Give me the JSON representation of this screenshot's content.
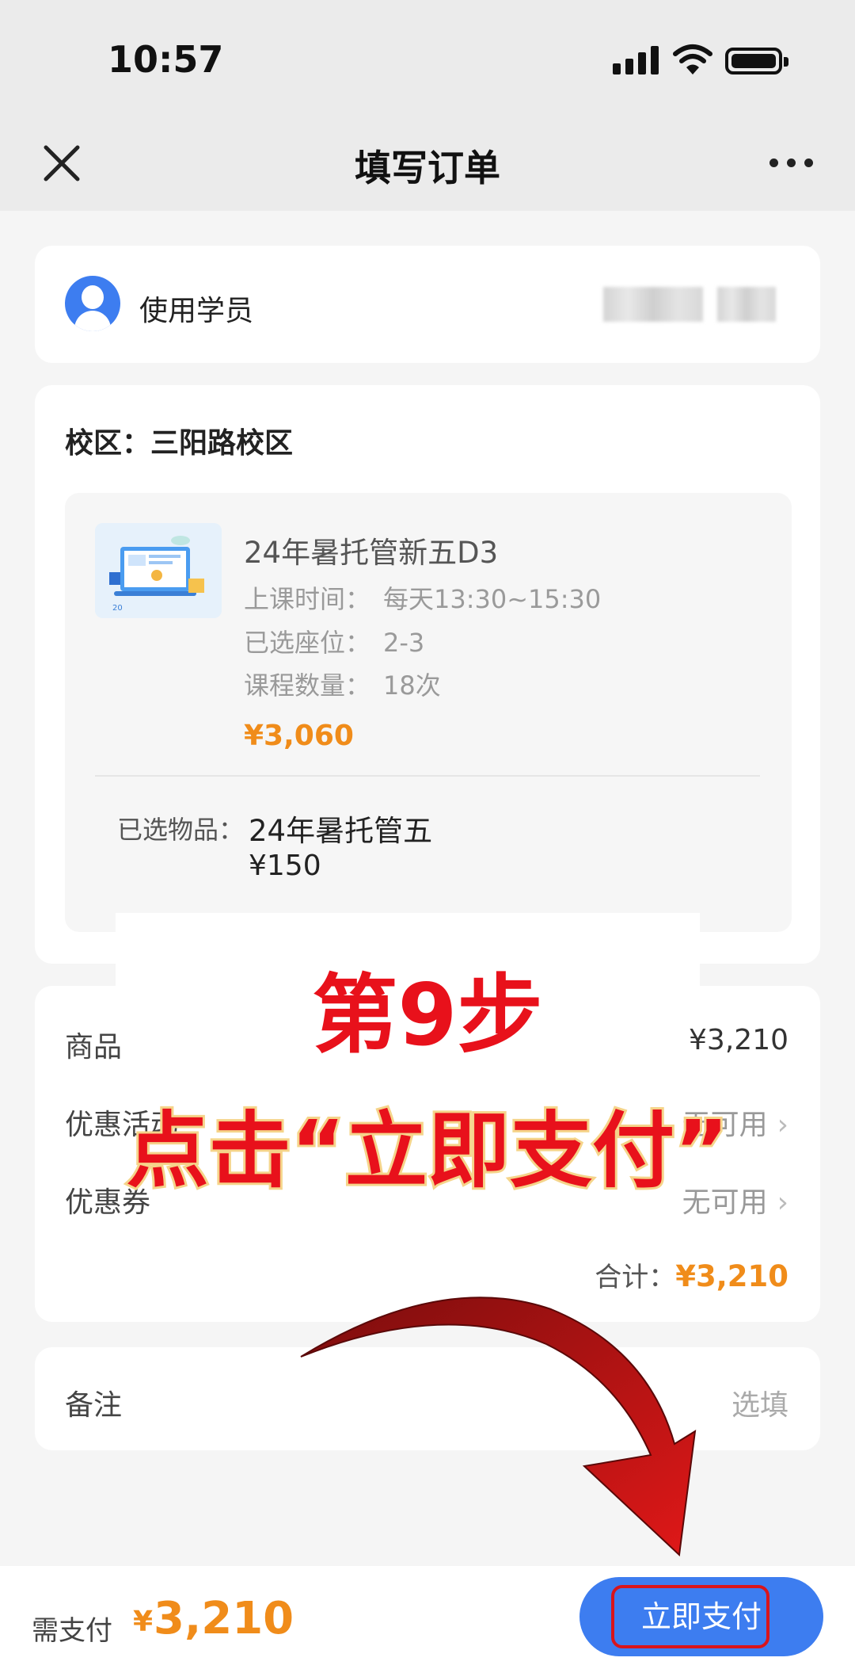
{
  "status_bar": {
    "time": "10:57"
  },
  "nav": {
    "title": "填写订单"
  },
  "student": {
    "label": "使用学员"
  },
  "order": {
    "campus": "校区：三阳路校区",
    "course": {
      "name": "24年暑托管新五D3",
      "time_label": "上课时间：",
      "time_value": "每天13:30~15:30",
      "seat_label": "已选座位：",
      "seat_value": "2-3",
      "count_label": "课程数量：",
      "count_value": "18次",
      "price": "¥3,060"
    },
    "item": {
      "label": "已选物品：",
      "name": "24年暑托管五",
      "price": "¥150"
    }
  },
  "summary": {
    "goods_label": "商品",
    "goods_value": "¥3,210",
    "promo_label": "优惠活动",
    "promo_value": "无可用",
    "coupon_label": "优惠券",
    "coupon_value": "无可用",
    "total_label": "合计：",
    "total_value": "¥3,210"
  },
  "remark": {
    "label": "备注",
    "placeholder": "选填"
  },
  "bottom": {
    "pay_label": "需支付",
    "currency": "¥",
    "amount": "3,210",
    "button_label": "立即支付"
  },
  "tutorial": {
    "step": "第9步",
    "instruction": "点击“立即支付”",
    "accent_color": "#e8111b"
  },
  "colors": {
    "primary": "#3d7df0",
    "price": "#f08c1a"
  }
}
